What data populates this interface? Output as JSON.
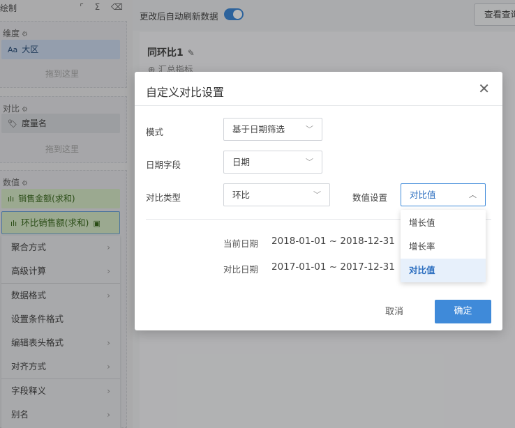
{
  "left_panel": {
    "title": "绘制",
    "tools": "⌜ Σ ⌫",
    "dimension": {
      "header": "维度",
      "field_prefix": "Aa",
      "field": "大区",
      "drop_hint": "拖到这里"
    },
    "compare": {
      "header": "对比",
      "field": "度量名",
      "drop_hint": "拖到这里"
    },
    "values": {
      "header": "数值",
      "fields": [
        "销售金额(求和)",
        "环比销售额(求和)"
      ]
    }
  },
  "context_menu": {
    "items": [
      {
        "label": "聚合方式",
        "has_submenu": true
      },
      {
        "label": "高级计算",
        "has_submenu": true
      },
      {
        "label": "数据格式",
        "has_submenu": true
      },
      {
        "label": "设置条件格式",
        "has_submenu": false
      },
      {
        "label": "编辑表头格式",
        "has_submenu": true
      },
      {
        "label": "对齐方式",
        "has_submenu": true
      },
      {
        "label": "字段释义",
        "has_submenu": true
      },
      {
        "label": "别名",
        "has_submenu": true
      }
    ]
  },
  "topbar": {
    "auto_refresh_label": "更改后自动刷新数据",
    "auto_refresh_on": true,
    "query_button": "查看查询"
  },
  "chart": {
    "title": "同环比1",
    "summary": "汇总指标"
  },
  "dialog": {
    "title": "自定义对比设置",
    "mode": {
      "label": "模式",
      "value": "基于日期筛选"
    },
    "date_field": {
      "label": "日期字段",
      "value": "日期"
    },
    "compare_type": {
      "label": "对比类型",
      "value": "环比"
    },
    "value_setting": {
      "label": "数值设置",
      "value": "对比值",
      "options": [
        "增长值",
        "增长率",
        "对比值"
      ],
      "selected_index": 2
    },
    "current_date": {
      "label": "当前日期",
      "value": "2018-01-01 ~ 2018-12-31"
    },
    "compare_date": {
      "label": "对比日期",
      "value": "2017-01-01 ~ 2017-12-31"
    },
    "cancel": "取消",
    "confirm": "确定"
  },
  "colors": {
    "accent": "#3f8ad9",
    "dimension_pill": "#cddcf0",
    "measure_pill": "#d7ebc8",
    "overlay": "rgba(0,0,0,0.28)"
  }
}
